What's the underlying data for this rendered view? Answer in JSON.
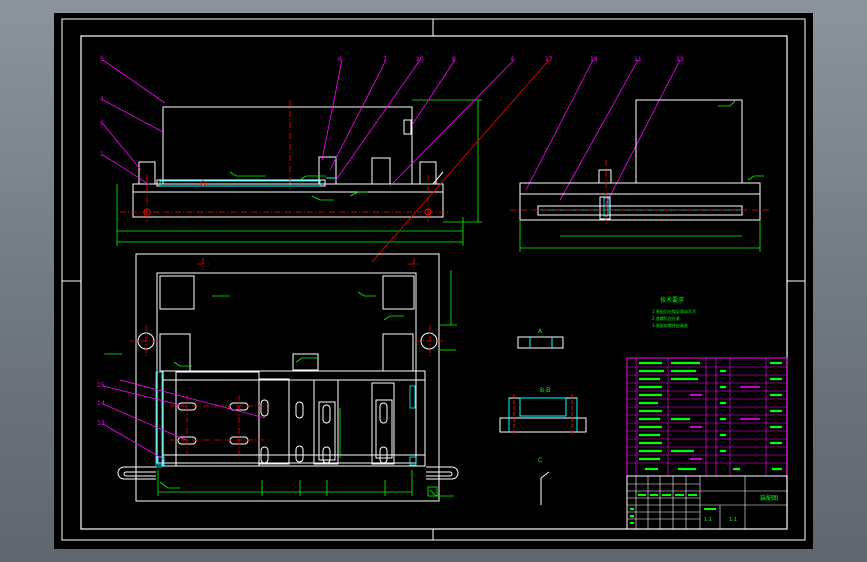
{
  "colors": {
    "background": "#6f7780",
    "sheet": "#000000",
    "line": "#ffffff",
    "dim": "#00ff00",
    "leader": "#ff00ff",
    "hidden": "#00ffff",
    "center": "#ff0000",
    "title_bar": "#2a8c8c"
  },
  "balloons_top": [
    "5",
    "4",
    "6",
    "1",
    "6",
    "7",
    "10",
    "8",
    "6",
    "17",
    "18",
    "11",
    "13"
  ],
  "balloons_left": [
    "15",
    "14",
    "13"
  ],
  "title_block": {
    "drawing_title": "装配图",
    "scale_1": "1:1",
    "scale_2": "1:1"
  },
  "tech_requirements": {
    "heading": "技术要求",
    "lines": [
      "1.装配后应保证滑动灵活",
      "2.各螺钉应拧紧",
      "3.装配前零件应清洗"
    ]
  },
  "section_labels": [
    "A",
    "B-B",
    "C"
  ]
}
